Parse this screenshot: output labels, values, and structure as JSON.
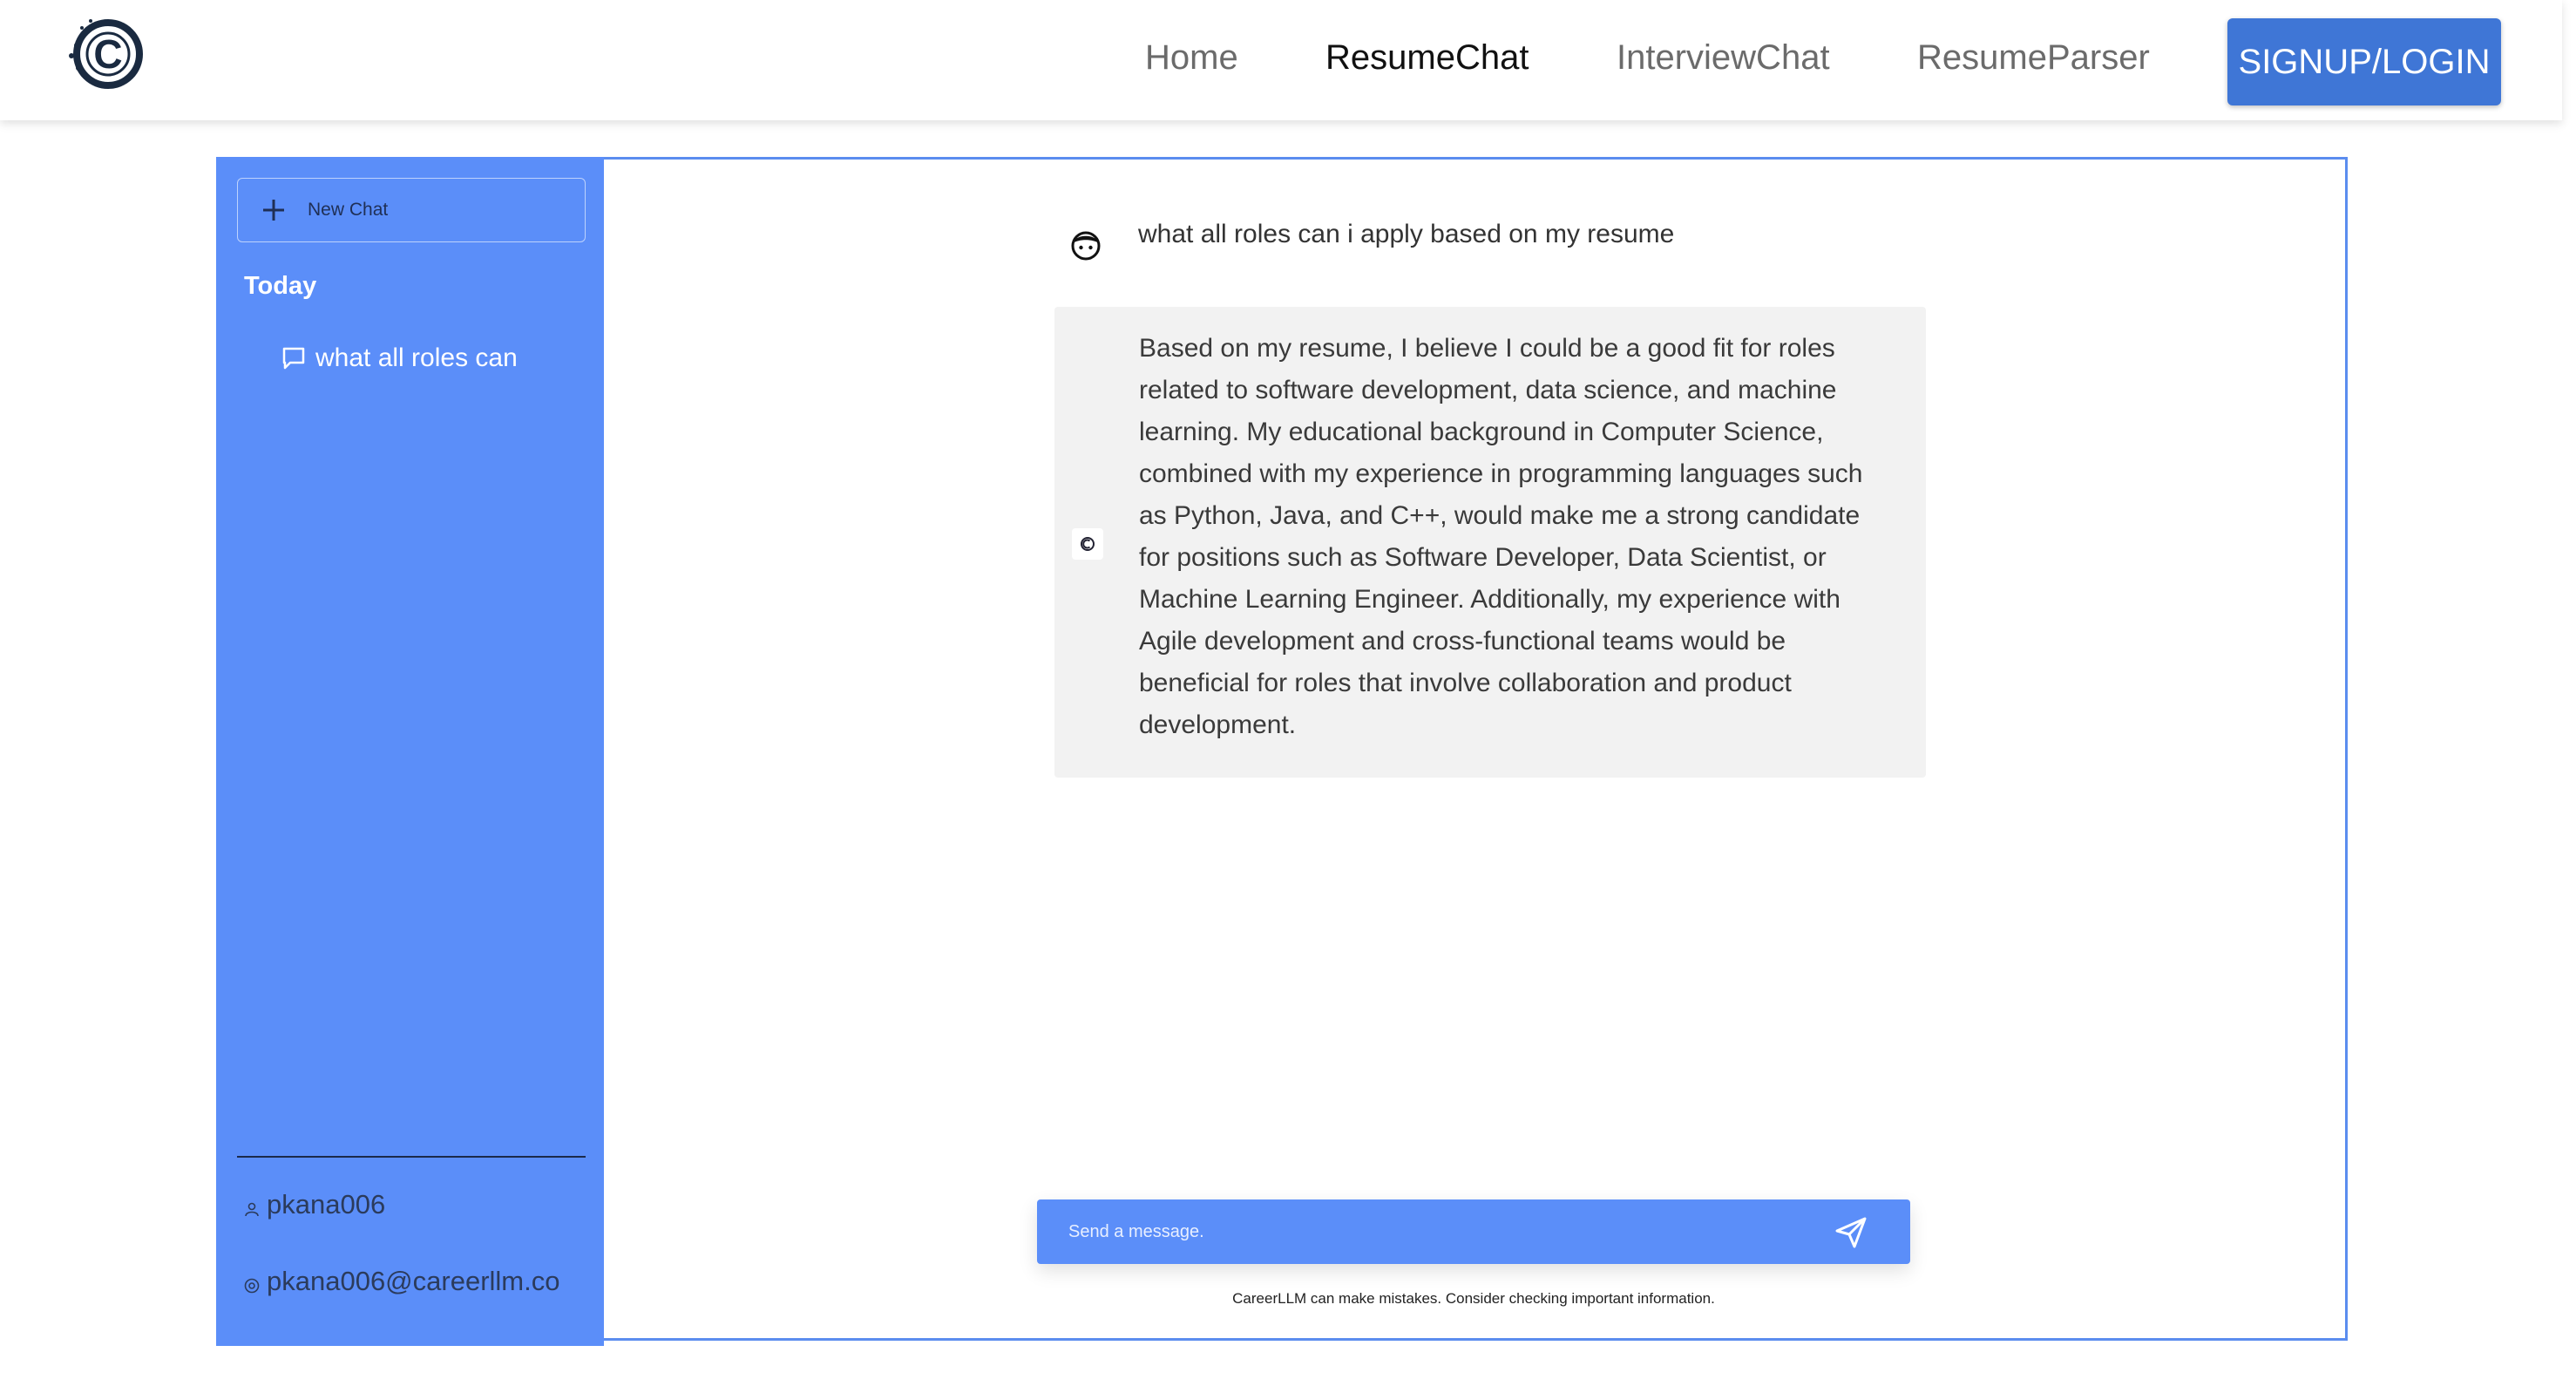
{
  "header": {
    "logo_letter": "C",
    "nav": {
      "home": "Home",
      "resume_chat": "ResumeChat",
      "interview_chat": "InterviewChat",
      "resume_parser": "ResumeParser"
    },
    "signup_label": "SIGNUP/LOGIN"
  },
  "sidebar": {
    "new_chat_label": "New Chat",
    "section_today": "Today",
    "history": [
      {
        "label": "what all roles can"
      }
    ],
    "user": {
      "username": "pkana006",
      "email": "pkana006@careerllm.co"
    }
  },
  "chat": {
    "messages": [
      {
        "role": "user",
        "text": "what all roles can i apply based on my resume"
      },
      {
        "role": "assistant",
        "text": "Based on my resume, I believe I could be a good fit for roles related to software development, data science, and machine learning. My educational background in Computer Science, combined with my experience in programming languages such as Python, Java, and C++, would make me a strong candidate for positions such as Software Developer, Data Scientist, or Machine Learning Engineer. Additionally, my experience with Agile development and cross-functional teams would be beneficial for roles that involve collaboration and product development."
      }
    ],
    "input": {
      "placeholder": "Send a message."
    },
    "disclaimer": "CareerLLM can make mistakes. Consider checking important information."
  },
  "colors": {
    "accent": "#5b8ef9",
    "button": "#3f76d6",
    "frame_border": "#5b8def",
    "assistant_bubble": "#f2f2f2"
  },
  "icons": {
    "logo": "careerllm-logo-icon",
    "new_chat": "plus-icon",
    "history": "chat-bubble-icon",
    "user": "user-icon",
    "email": "at-icon",
    "user_avatar": "user-avatar-icon",
    "bot_avatar": "bot-avatar-icon",
    "send": "send-icon"
  }
}
